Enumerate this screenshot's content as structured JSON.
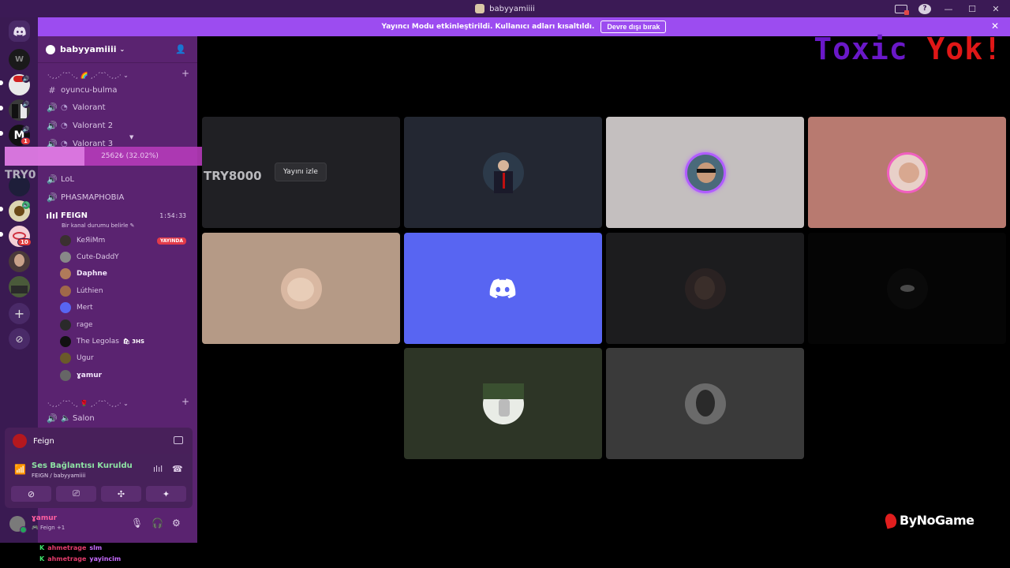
{
  "window": {
    "title": "babyyamiiii"
  },
  "banner": {
    "text": "Yayıncı Modu etkinleştirildi. Kullanıcı adları kısaltıldı.",
    "button": "Devre dışı bırak"
  },
  "server": {
    "name": "babyyamiiii"
  },
  "categories": [
    {
      "label": "·.¸¸.·´¯`·.¸ 🌈 ¸.·´¯`·.¸¸.· ⌄"
    },
    {
      "label": "·.¸¸.·´¯`·.¸ 🌹 ¸.·´¯`·.¸¸.· ⌄"
    }
  ],
  "channels": [
    {
      "name": "oyuncu-bulma"
    },
    {
      "name": "Valorant"
    },
    {
      "name": "Valorant 2"
    },
    {
      "name": "Valorant 3"
    },
    {
      "name": "LoL"
    },
    {
      "name": "PHASMAPHOBIA"
    },
    {
      "name": "FEIGN",
      "timer": "1:54:33",
      "status": "Bir kanal durumu belirle ✎"
    },
    {
      "name": "Salon"
    }
  ],
  "voice_users": [
    {
      "name": "KeЯiMm",
      "live": "YAYINDA"
    },
    {
      "name": "Cute-DaddY"
    },
    {
      "name": "Daphne"
    },
    {
      "name": "Lúthien"
    },
    {
      "name": "Mert"
    },
    {
      "name": "rage"
    },
    {
      "name": "The Legolas",
      "tag": "🛍 3HS"
    },
    {
      "name": "Ugur"
    },
    {
      "name": "ɣamur"
    }
  ],
  "stream_card": {
    "name": "Feign"
  },
  "voice_panel": {
    "title": "Ses Bağlantısı Kuruldu",
    "sub": "FEIGN / babyyamiiii"
  },
  "user_panel": {
    "name": "ɣamur",
    "sub": "🎮 Feign +1"
  },
  "chat": [
    {
      "user": "ahmetrage",
      "msg": "slm"
    },
    {
      "user": "ahmetrage",
      "msg": "yayincim"
    }
  ],
  "overlay": {
    "text": "2562₺ (32.02%)",
    "progress": 0.32,
    "label": "TRY0"
  },
  "toxic": {
    "a": "Toxic ",
    "b": "Yok!"
  },
  "tiles": {
    "stream_owner": "TRY8000",
    "watch": "Yayını izle"
  },
  "brand": {
    "name": "ByNoGame"
  },
  "badges": {
    "srv1": "1",
    "srv2": "10"
  },
  "colors": {
    "sidebar": "#5a2370",
    "rail": "#3a1a52",
    "banner": "#9c4cf0",
    "connected": "#8ee3a4",
    "live": "#e23b4a"
  }
}
